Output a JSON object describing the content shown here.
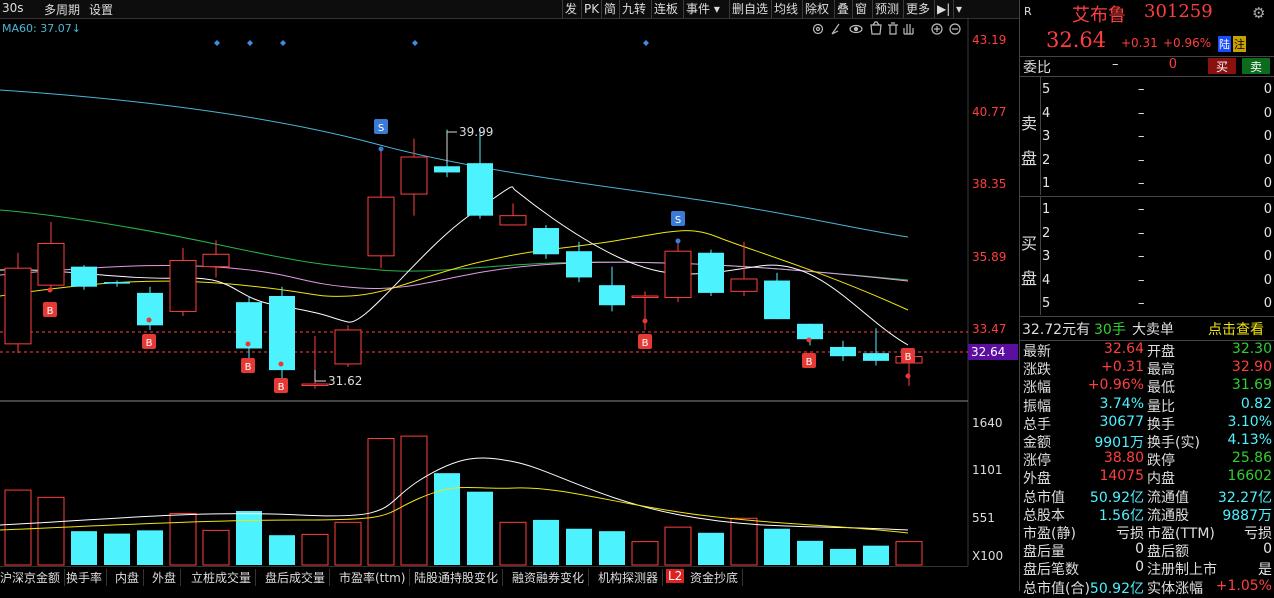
{
  "toolbar": {
    "period": "30s",
    "multi_period": "多周期",
    "settings": "设置",
    "buttons": [
      "发",
      "PK",
      "简",
      "九转",
      "连板",
      "事件 ▾",
      "删自选",
      "均线",
      "除权",
      "叠",
      "窗",
      "预测",
      "更多",
      "▶|",
      "▾"
    ]
  },
  "indicator_label": "MA60: 37.07↓",
  "price_axis": [
    "43.19",
    "40.77",
    "38.35",
    "35.89",
    "33.47",
    "32.64"
  ],
  "volume_axis": [
    "1640",
    "1101",
    "551",
    "X100"
  ],
  "annotations": {
    "high": "39.99",
    "low": "31.62"
  },
  "bottom_tabs": [
    "沪深京金额",
    "换手率",
    "内盘",
    "外盘",
    "立桩成交量",
    "盘后成交量",
    "市盈率(ttm)",
    "陆股通持股变化",
    "融资融券变化",
    "机构探测器",
    "L2",
    "资金抄底"
  ],
  "colors": {
    "up": "#ff3f3f",
    "down": "#4df2ff",
    "ma60": "#4ab7d8",
    "ma_white": "#ffffff",
    "ma_yellow": "#f2e40f",
    "ma_pink": "#e59ae6",
    "ma_green": "#27b54a"
  },
  "chart_data": {
    "type": "candlestick",
    "price_range": [
      31.2,
      43.6
    ],
    "volume_range": [
      0,
      1800
    ],
    "candles": [
      {
        "o": 33.05,
        "c": 35.5,
        "h": 36.0,
        "l": 32.75,
        "v": 930
      },
      {
        "o": 34.95,
        "c": 36.3,
        "h": 37.0,
        "l": 34.85,
        "v": 840
      },
      {
        "o": 35.55,
        "c": 34.9,
        "h": 35.6,
        "l": 34.8,
        "v": 420
      },
      {
        "o": 35.05,
        "c": 35.0,
        "h": 35.1,
        "l": 34.9,
        "v": 390
      },
      {
        "o": 34.7,
        "c": 33.65,
        "h": 34.9,
        "l": 33.5,
        "v": 430
      },
      {
        "o": 34.1,
        "c": 35.75,
        "h": 36.15,
        "l": 33.95,
        "v": 640
      },
      {
        "o": 35.55,
        "c": 35.95,
        "h": 36.4,
        "l": 35.2,
        "v": 430
      },
      {
        "o": 34.4,
        "c": 32.9,
        "h": 34.6,
        "l": 32.5,
        "v": 670
      },
      {
        "o": 34.6,
        "c": 32.2,
        "h": 34.9,
        "l": 31.9,
        "v": 370
      },
      {
        "o": 31.75,
        "c": 31.75,
        "h": 33.3,
        "l": 31.6,
        "v": 380
      },
      {
        "o": 32.4,
        "c": 33.5,
        "h": 33.65,
        "l": 32.3,
        "v": 530
      },
      {
        "o": 35.9,
        "c": 37.8,
        "h": 39.3,
        "l": 35.5,
        "v": 1570
      },
      {
        "o": 37.9,
        "c": 39.1,
        "h": 39.7,
        "l": 37.2,
        "v": 1600
      },
      {
        "o": 38.8,
        "c": 38.6,
        "h": 39.99,
        "l": 38.45,
        "v": 1140
      },
      {
        "o": 38.9,
        "c": 37.2,
        "h": 39.99,
        "l": 37.1,
        "v": 910
      },
      {
        "o": 36.9,
        "c": 37.2,
        "h": 37.6,
        "l": 36.9,
        "v": 530
      },
      {
        "o": 36.8,
        "c": 35.95,
        "h": 36.9,
        "l": 35.8,
        "v": 560
      },
      {
        "o": 36.05,
        "c": 35.2,
        "h": 36.35,
        "l": 35.05,
        "v": 450
      },
      {
        "o": 34.95,
        "c": 34.3,
        "h": 35.55,
        "l": 34.1,
        "v": 420
      },
      {
        "o": 34.6,
        "c": 34.6,
        "h": 34.75,
        "l": 33.5,
        "v": 290
      },
      {
        "o": 34.55,
        "c": 36.05,
        "h": 36.35,
        "l": 34.4,
        "v": 470
      },
      {
        "o": 36.0,
        "c": 34.7,
        "h": 36.1,
        "l": 34.6,
        "v": 400
      },
      {
        "o": 34.75,
        "c": 35.15,
        "h": 36.35,
        "l": 34.6,
        "v": 580
      },
      {
        "o": 35.1,
        "c": 33.85,
        "h": 35.35,
        "l": 33.85,
        "v": 450
      },
      {
        "o": 33.7,
        "c": 33.2,
        "h": 33.7,
        "l": 33.0,
        "v": 300
      },
      {
        "o": 32.95,
        "c": 32.65,
        "h": 33.15,
        "l": 32.5,
        "v": 200
      },
      {
        "o": 32.75,
        "c": 32.5,
        "h": 33.55,
        "l": 32.35,
        "v": 240
      },
      {
        "o": 32.43,
        "c": 32.64,
        "h": 32.9,
        "l": 31.69,
        "v": 290
      }
    ]
  },
  "panel": {
    "r": "R",
    "name": "艾布鲁",
    "code": "301259",
    "price": "32.64",
    "change": "+0.31",
    "pct": "+0.96%",
    "tag1": "陆",
    "tag2": "注",
    "weibi_label": "委比",
    "weibi_dash": "–",
    "weibi_val": "0",
    "buy_btn": "买",
    "sell_btn": "卖",
    "sell_label": [
      "卖",
      "盘"
    ],
    "buy_label": [
      "买",
      "盘"
    ],
    "sell_rows": [
      {
        "n": "5",
        "p": "–",
        "v": "0"
      },
      {
        "n": "4",
        "p": "–",
        "v": "0"
      },
      {
        "n": "3",
        "p": "–",
        "v": "0"
      },
      {
        "n": "2",
        "p": "–",
        "v": "0"
      },
      {
        "n": "1",
        "p": "–",
        "v": "0"
      }
    ],
    "buy_rows": [
      {
        "n": "1",
        "p": "–",
        "v": "0"
      },
      {
        "n": "2",
        "p": "–",
        "v": "0"
      },
      {
        "n": "3",
        "p": "–",
        "v": "0"
      },
      {
        "n": "4",
        "p": "–",
        "v": "0"
      },
      {
        "n": "5",
        "p": "–",
        "v": "0"
      }
    ],
    "big_order_price": "32.72元有",
    "big_order_hands": "30手",
    "big_order_label": "大卖单",
    "big_order_link": "点击查看",
    "stats": [
      {
        "l1": "最新",
        "v1": "32.64",
        "c1": "red",
        "l2": "开盘",
        "v2": "32.30",
        "c2": "green"
      },
      {
        "l1": "涨跌",
        "v1": "+0.31",
        "c1": "red",
        "l2": "最高",
        "v2": "32.90",
        "c2": "red"
      },
      {
        "l1": "涨幅",
        "v1": "+0.96%",
        "c1": "red",
        "l2": "最低",
        "v2": "31.69",
        "c2": "green"
      },
      {
        "l1": "振幅",
        "v1": "3.74%",
        "c1": "cyan",
        "l2": "量比",
        "v2": "0.82",
        "c2": "cyan"
      },
      {
        "l1": "总手",
        "v1": "30677",
        "c1": "cyan",
        "l2": "换手",
        "v2": "3.10%",
        "c2": "cyan"
      },
      {
        "l1": "金额",
        "v1": "9901万",
        "c1": "cyan",
        "l2": "换手(实)",
        "v2": "4.13%",
        "c2": "cyan"
      },
      {
        "l1": "涨停",
        "v1": "38.80",
        "c1": "red",
        "l2": "跌停",
        "v2": "25.86",
        "c2": "green"
      },
      {
        "l1": "外盘",
        "v1": "14075",
        "c1": "red",
        "l2": "内盘",
        "v2": "16602",
        "c2": "green"
      },
      {
        "l1": "总市值",
        "v1": "50.92亿",
        "c1": "cyan",
        "l2": "流通值",
        "v2": "32.27亿",
        "c2": "cyan"
      },
      {
        "l1": "总股本",
        "v1": "1.56亿",
        "c1": "cyan",
        "l2": "流通股",
        "v2": "9887万",
        "c2": "cyan"
      },
      {
        "l1": "市盈(静)",
        "v1": "亏损",
        "c1": "white",
        "l2": "市盈(TTM)",
        "v2": "亏损",
        "c2": "white"
      },
      {
        "l1": "盘后量",
        "v1": "0",
        "c1": "white",
        "l2": "盘后额",
        "v2": "0",
        "c2": "white"
      },
      {
        "l1": "盘后笔数",
        "v1": "0",
        "c1": "white",
        "l2": "注册制上市",
        "v2": "是",
        "c2": "white"
      },
      {
        "l1": "总市值(合)",
        "v1": "50.92亿",
        "c1": "cyan",
        "l2": "实体涨幅",
        "v2": "+1.05%",
        "c2": "red"
      }
    ]
  }
}
